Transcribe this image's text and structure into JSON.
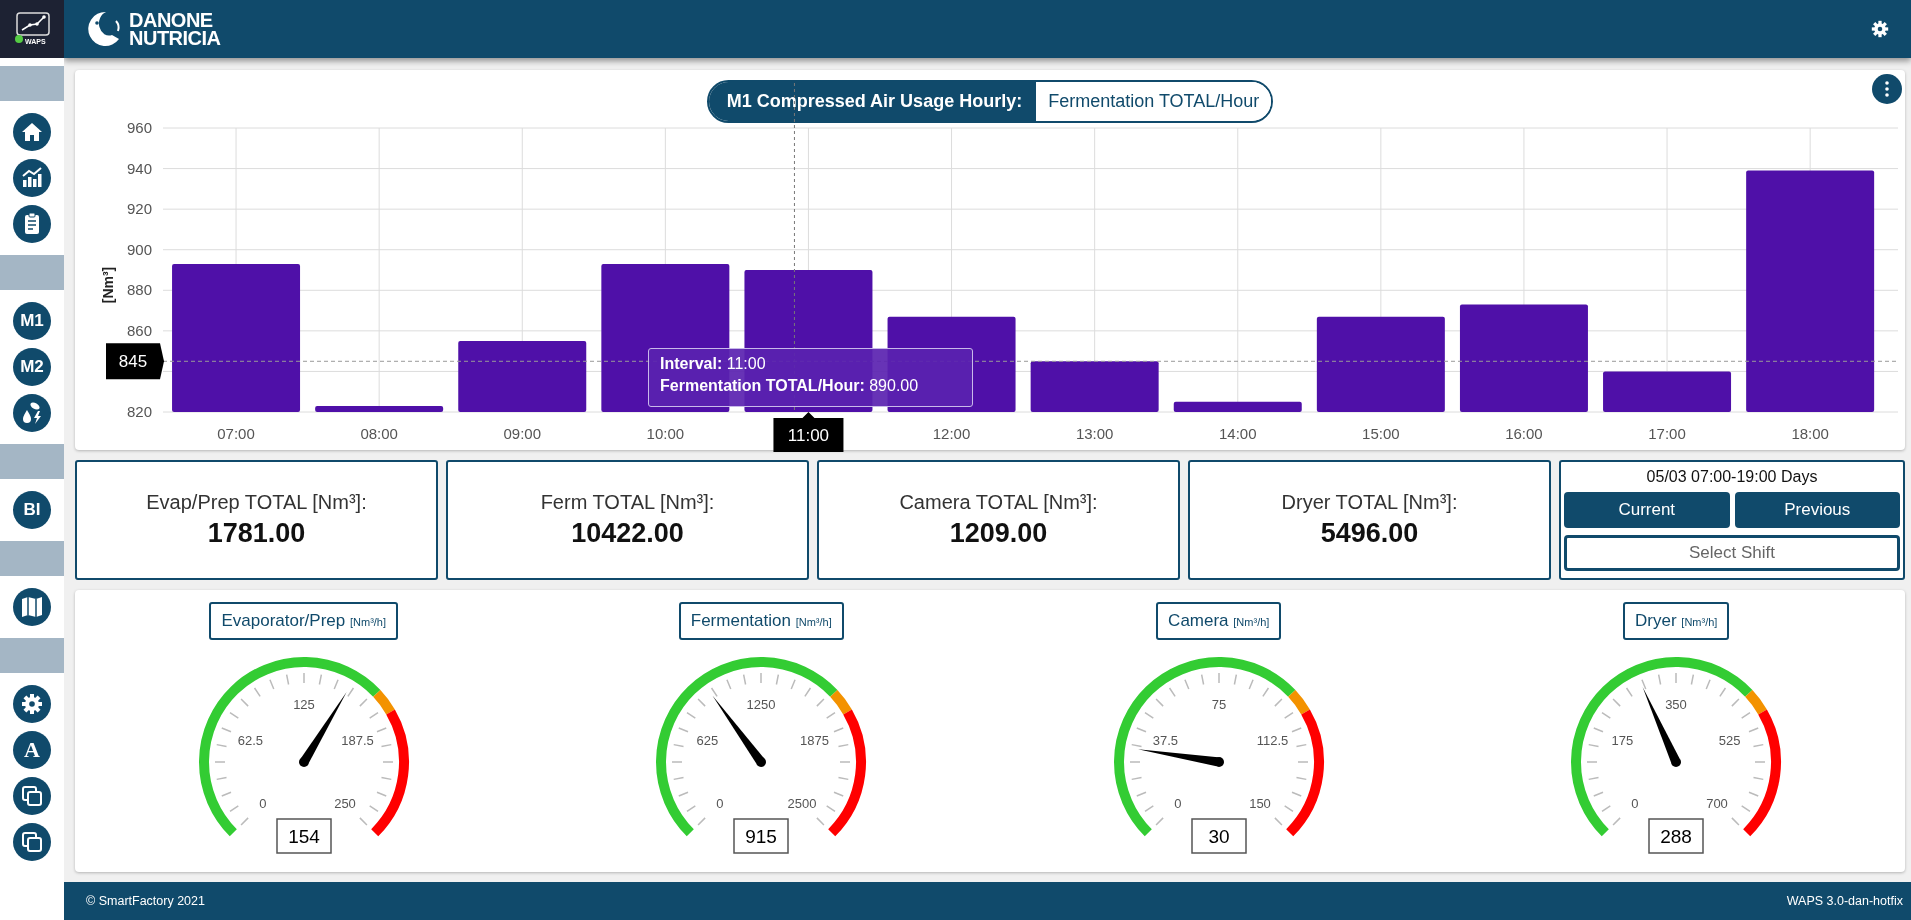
{
  "app_logo_text": "WAPS",
  "brand": [
    "DANONE",
    "NUTRICIA"
  ],
  "sidebar": {
    "labels": [
      "M1",
      "M2",
      "BI",
      "A"
    ]
  },
  "chart_card": {
    "title": "M1 Compressed Air Usage Hourly:",
    "metric": "Fermentation TOTAL/Hour",
    "chart_data": {
      "type": "bar",
      "ylabel": "[Nm³]",
      "categories": [
        "07:00",
        "08:00",
        "09:00",
        "10:00",
        "11:00",
        "12:00",
        "13:00",
        "14:00",
        "15:00",
        "16:00",
        "17:00",
        "18:00"
      ],
      "series": [
        {
          "color": "#4f10a8",
          "values": [
            893,
            823,
            855,
            893,
            890,
            867,
            845,
            825,
            867,
            873,
            840,
            939
          ]
        }
      ],
      "ylim": [
        820,
        960
      ],
      "yticks": [
        820,
        860,
        880,
        900,
        920,
        940,
        960
      ],
      "grid": true,
      "ref_lines": [
        {
          "axis": "x",
          "value": "11:00"
        },
        {
          "axis": "y",
          "value": 845,
          "label": "845"
        }
      ]
    },
    "tooltip": [
      "**Interval:** 11:00",
      "**Fermentation TOTAL/Hour:** 890.00"
    ]
  },
  "totals": [
    {
      "label": "Evap/Prep TOTAL [Nm³]:",
      "value": "1781.00"
    },
    {
      "label": "Ferm TOTAL [Nm³]:",
      "value": "10422.00"
    },
    {
      "label": "Camera TOTAL [Nm³]:",
      "value": "1209.00"
    },
    {
      "label": "Dryer TOTAL [Nm³]:",
      "value": "5496.00"
    }
  ],
  "shift": {
    "title": "05/03 07:00-19:00 Days",
    "buttons": [
      "Current",
      "Previous"
    ],
    "select": "Select Shift"
  },
  "gauges": [
    {
      "title": "Evaporator/Prep",
      "unit": "[Nm³/h]",
      "scale": [
        "0",
        "62.5",
        "125",
        "187.5",
        "250"
      ],
      "value": "154",
      "level": 0.616
    },
    {
      "title": "Fermentation",
      "unit": "[Nm³/h]",
      "scale": [
        "0",
        "625",
        "1250",
        "1875",
        "2500"
      ],
      "value": "915",
      "level": 0.366
    },
    {
      "title": "Camera",
      "unit": "[Nm³/h]",
      "scale": [
        "0",
        "37.5",
        "75",
        "112.5",
        "150"
      ],
      "value": "30",
      "level": 0.2
    },
    {
      "title": "Dryer",
      "unit": "[Nm³/h]",
      "scale": [
        "0",
        "175",
        "350",
        "525",
        "700"
      ],
      "value": "288",
      "level": 0.411
    }
  ],
  "footer": {
    "left": "© SmartFactory 2021",
    "right": "WAPS 3.0-dan-hotfix"
  }
}
